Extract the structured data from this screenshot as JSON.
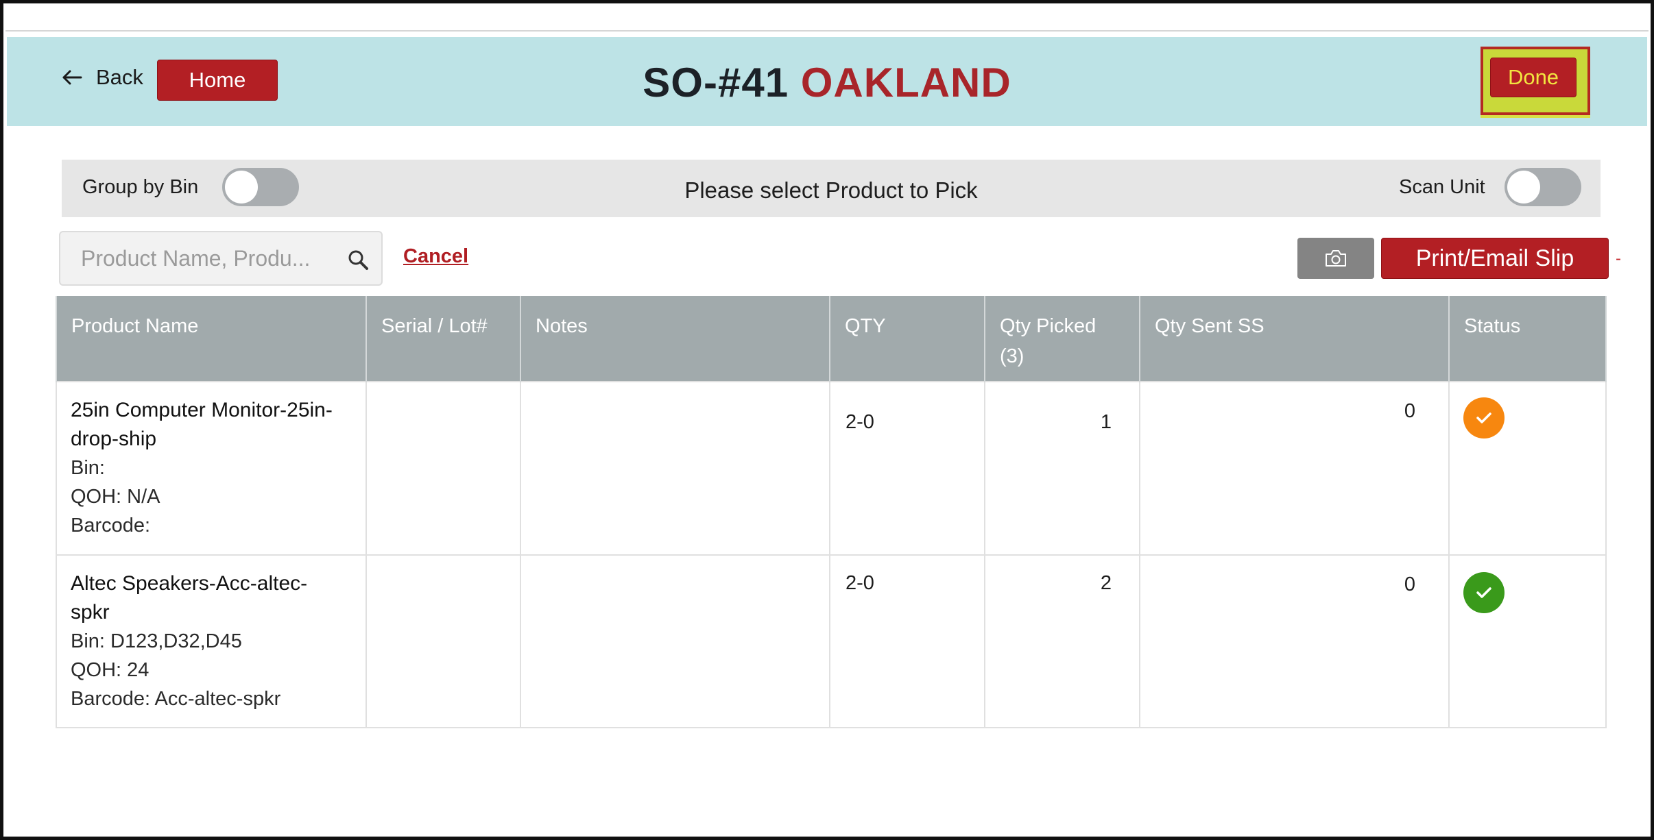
{
  "header": {
    "back_label": "Back",
    "home_label": "Home",
    "order_number": "SO-#41",
    "location": "OAKLAND",
    "done_label": "Done",
    "colors": {
      "header_bg": "#bde3e6",
      "brand_red": "#b31f24",
      "done_highlight": "#c9d93a"
    }
  },
  "toolbar": {
    "group_by_bin_label": "Group by Bin",
    "group_by_bin_on": false,
    "prompt": "Please select Product to Pick",
    "scan_unit_label": "Scan Unit",
    "scan_unit_on": false
  },
  "search": {
    "placeholder": "Product Name, Produ...",
    "value": "",
    "icon": "search-icon"
  },
  "actions": {
    "cancel_label": "Cancel",
    "camera_icon": "camera-icon",
    "print_label": "Print/Email Slip",
    "dash": "-"
  },
  "table": {
    "headers": {
      "product_name": "Product Name",
      "serial_lot": "Serial / Lot#",
      "notes": "Notes",
      "qty": "QTY",
      "qty_picked": "Qty Picked",
      "qty_picked_count": "(3)",
      "qty_sent_ss": "Qty Sent SS",
      "status": "Status"
    },
    "rows": [
      {
        "name_line1": "25in Computer Monitor-25in-",
        "name_line2": "drop-ship",
        "bin": "Bin:",
        "qoh": "QOH: N/A",
        "barcode": "Barcode:",
        "serial_lot": "",
        "notes": "",
        "qty": "2-0",
        "qty_picked": "1",
        "qty_sent_ss": "0",
        "status": "partial",
        "status_color": "#f7870f"
      },
      {
        "name_line1": "Altec Speakers-Acc-altec-",
        "name_line2": "spkr",
        "bin": "Bin: D123,D32,D45",
        "qoh": "QOH: 24",
        "barcode": "Barcode: Acc-altec-spkr",
        "serial_lot": "",
        "notes": "",
        "qty": "2-0",
        "qty_picked": "2",
        "qty_sent_ss": "0",
        "status": "complete",
        "status_color": "#3a9a1b"
      }
    ]
  }
}
